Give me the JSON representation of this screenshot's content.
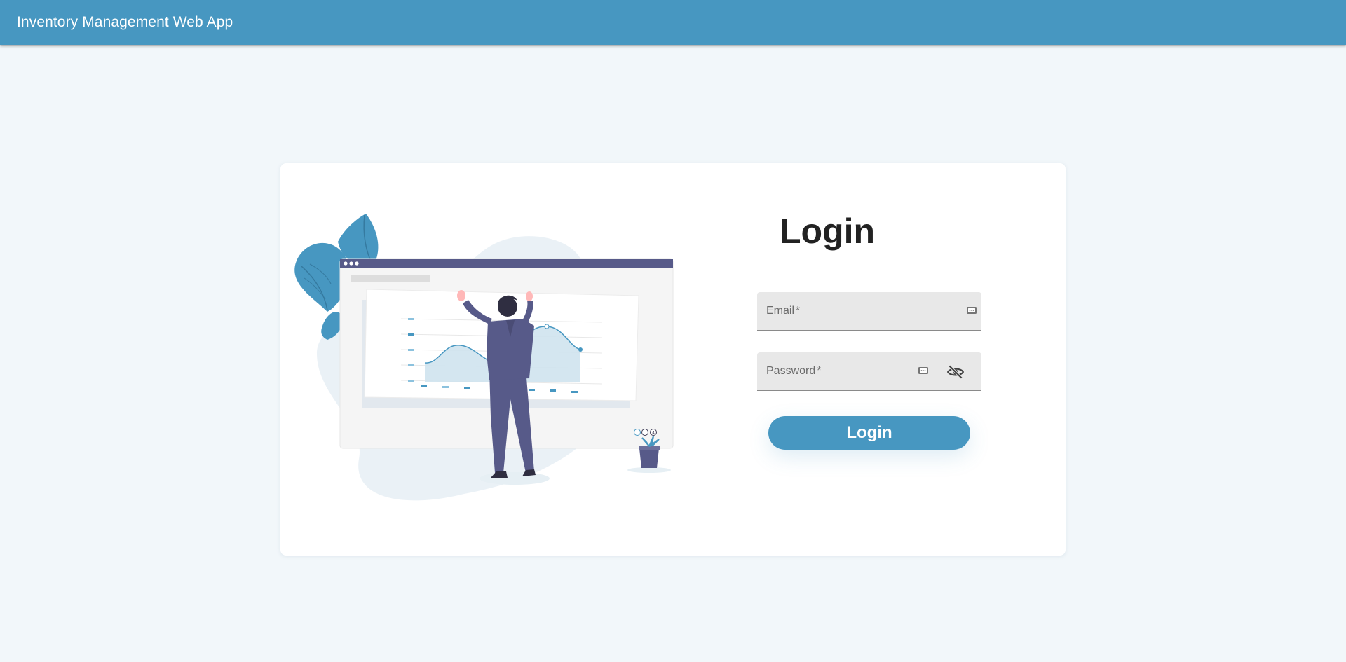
{
  "appbar": {
    "title": "Inventory Management Web App",
    "color": "#4797c1"
  },
  "login": {
    "heading": "Login",
    "email": {
      "label": "Email",
      "required_mark": "*",
      "value": "",
      "icon": "autofill-key-icon"
    },
    "password": {
      "label": "Password",
      "required_mark": "*",
      "value": "",
      "icon": "autofill-key-icon",
      "toggle_icon": "eye-off-icon"
    },
    "submit_label": "Login"
  },
  "illustration": {
    "description_icon": "analytics-illustration",
    "pagination_dots": [
      "3",
      "4"
    ],
    "accent_color": "#4797c1",
    "figure_color": "#575a89"
  }
}
